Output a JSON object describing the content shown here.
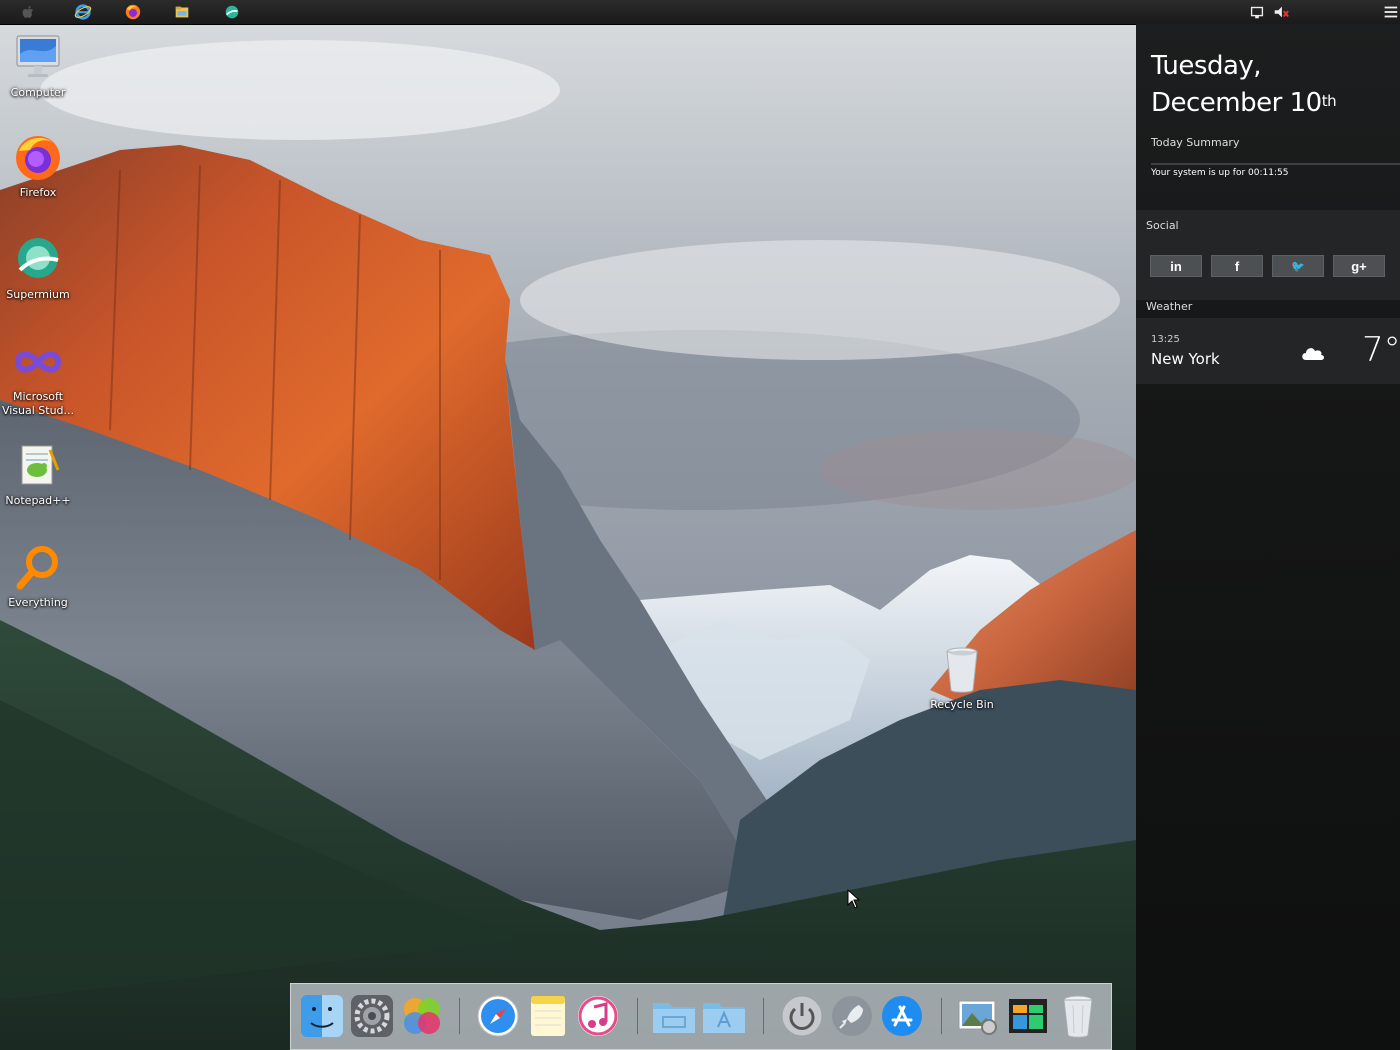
{
  "topbar": {
    "items": [
      {
        "name": "apple-menu-icon"
      },
      {
        "name": "internet-explorer-icon"
      },
      {
        "name": "firefox-icon"
      },
      {
        "name": "file-explorer-icon"
      },
      {
        "name": "supermium-icon"
      }
    ],
    "tray": [
      {
        "name": "network-icon"
      },
      {
        "name": "volume-muted-icon"
      },
      {
        "name": "menu-icon"
      }
    ]
  },
  "desktop": {
    "icons": [
      {
        "label": "Computer",
        "icon": "computer-icon"
      },
      {
        "label": "Firefox",
        "icon": "firefox-icon"
      },
      {
        "label": "Supermium",
        "icon": "supermium-icon"
      },
      {
        "label": "Microsoft Visual Stud...",
        "icon": "visual-studio-icon"
      },
      {
        "label": "Notepad++",
        "icon": "notepad-plus-plus-icon"
      },
      {
        "label": "Everything",
        "icon": "everything-search-icon"
      },
      {
        "label": "Recycle Bin",
        "icon": "recycle-bin-icon"
      }
    ]
  },
  "panel": {
    "day": "Tuesday,",
    "date": "December 10",
    "date_suffix": "th",
    "summary_title": "Today Summary",
    "summary_text": "Your system is up for 00:11:55",
    "social_title": "Social",
    "social": [
      {
        "label": "in",
        "icon": "linkedin-icon"
      },
      {
        "label": "f",
        "icon": "facebook-icon"
      },
      {
        "label": "🐦",
        "icon": "twitter-icon"
      },
      {
        "label": "g+",
        "icon": "google-plus-icon"
      }
    ],
    "weather_title": "Weather",
    "weather_time": "13:25",
    "weather_city": "New York",
    "weather_temp": "7°",
    "weather_icon": "cloud-icon"
  },
  "dock": {
    "items": [
      {
        "name": "finder-icon"
      },
      {
        "name": "system-preferences-icon"
      },
      {
        "name": "photos-icon"
      },
      {
        "name": "safari-icon"
      },
      {
        "name": "notes-icon"
      },
      {
        "name": "itunes-icon"
      },
      {
        "name": "folder-icon"
      },
      {
        "name": "applications-folder-icon"
      },
      {
        "name": "power-icon"
      },
      {
        "name": "launchpad-icon"
      },
      {
        "name": "app-store-icon"
      },
      {
        "name": "image-viewer-icon"
      },
      {
        "name": "task-manager-icon"
      },
      {
        "name": "trash-icon"
      }
    ]
  },
  "colors": {
    "panel_bg": "#1c1e1f",
    "panel_section": "#232526",
    "social_button": "#4d5053",
    "dock_bg": "#c8cdd4"
  }
}
